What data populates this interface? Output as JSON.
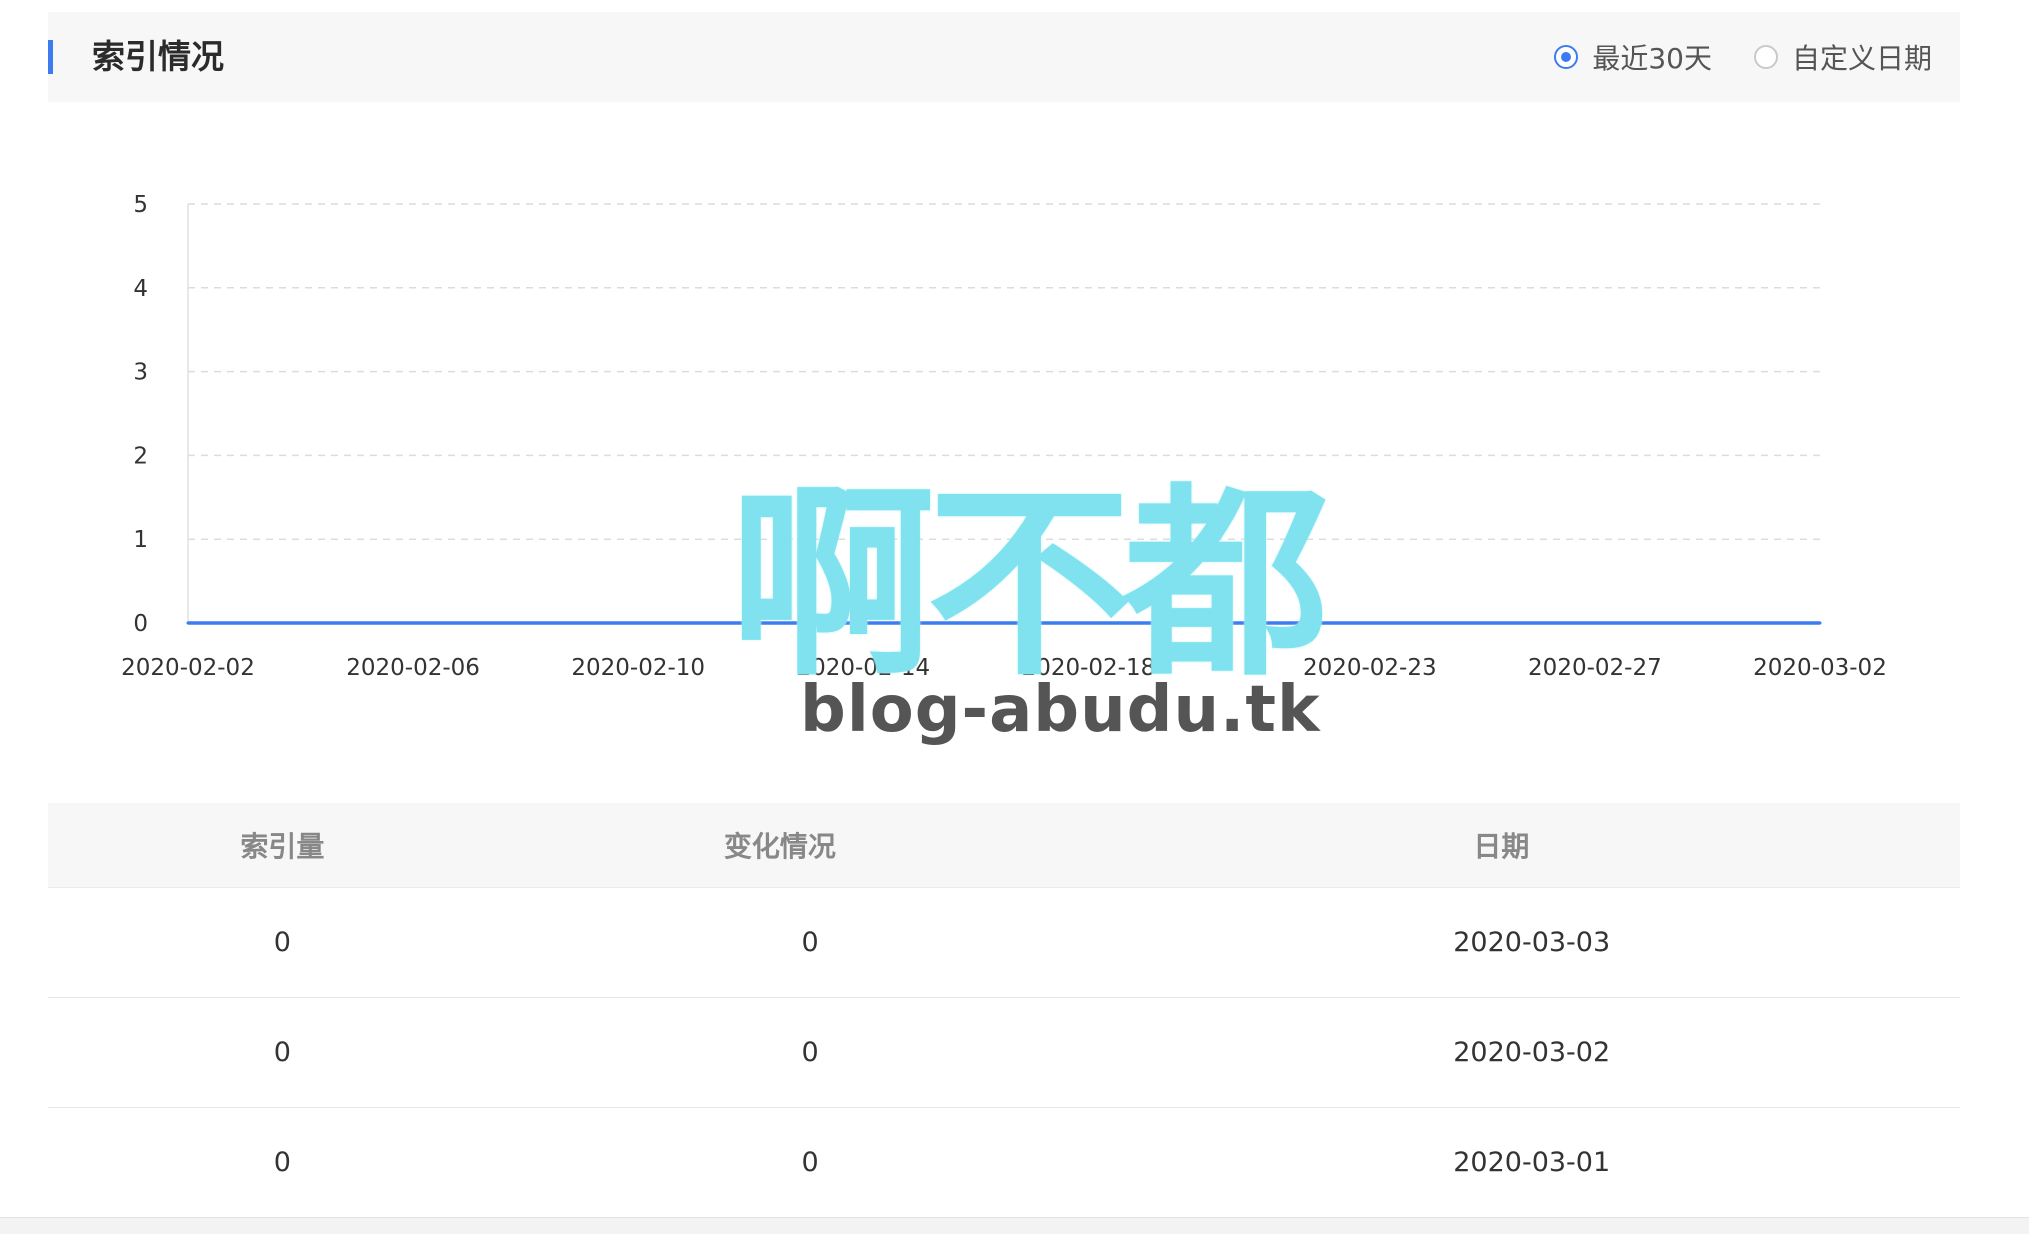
{
  "header": {
    "title": "索引情况",
    "options": [
      {
        "label": "最近30天",
        "checked": true
      },
      {
        "label": "自定义日期",
        "checked": false
      }
    ]
  },
  "chart_data": {
    "type": "line",
    "x": [
      "2020-02-02",
      "2020-02-03",
      "2020-02-04",
      "2020-02-05",
      "2020-02-06",
      "2020-02-07",
      "2020-02-08",
      "2020-02-09",
      "2020-02-10",
      "2020-02-11",
      "2020-02-12",
      "2020-02-13",
      "2020-02-14",
      "2020-02-15",
      "2020-02-16",
      "2020-02-17",
      "2020-02-18",
      "2020-02-19",
      "2020-02-20",
      "2020-02-21",
      "2020-02-22",
      "2020-02-23",
      "2020-02-24",
      "2020-02-25",
      "2020-02-26",
      "2020-02-27",
      "2020-02-28",
      "2020-02-29",
      "2020-03-01",
      "2020-03-02"
    ],
    "xtick_labels": [
      "2020-02-02",
      "2020-02-06",
      "2020-02-10",
      "2020-02-14",
      "2020-02-18",
      "2020-02-23",
      "2020-02-27",
      "2020-03-02"
    ],
    "series": [
      {
        "values": [
          0,
          0,
          0,
          0,
          0,
          0,
          0,
          0,
          0,
          0,
          0,
          0,
          0,
          0,
          0,
          0,
          0,
          0,
          0,
          0,
          0,
          0,
          0,
          0,
          0,
          0,
          0,
          0,
          0,
          0
        ],
        "color": "#3d7cf0"
      }
    ],
    "yticks": [
      0,
      1,
      2,
      3,
      4,
      5
    ],
    "ylim": [
      0,
      5
    ],
    "grid": true,
    "title": "",
    "xlabel": "",
    "ylabel": ""
  },
  "watermark": {
    "cjk": "啊不都",
    "latin": "blog-abudu.tk"
  },
  "table": {
    "headers": [
      "索引量",
      "变化情况",
      "日期"
    ],
    "rows": [
      [
        "0",
        "0",
        "2020-03-03"
      ],
      [
        "0",
        "0",
        "2020-03-02"
      ],
      [
        "0",
        "0",
        "2020-03-01"
      ]
    ]
  }
}
